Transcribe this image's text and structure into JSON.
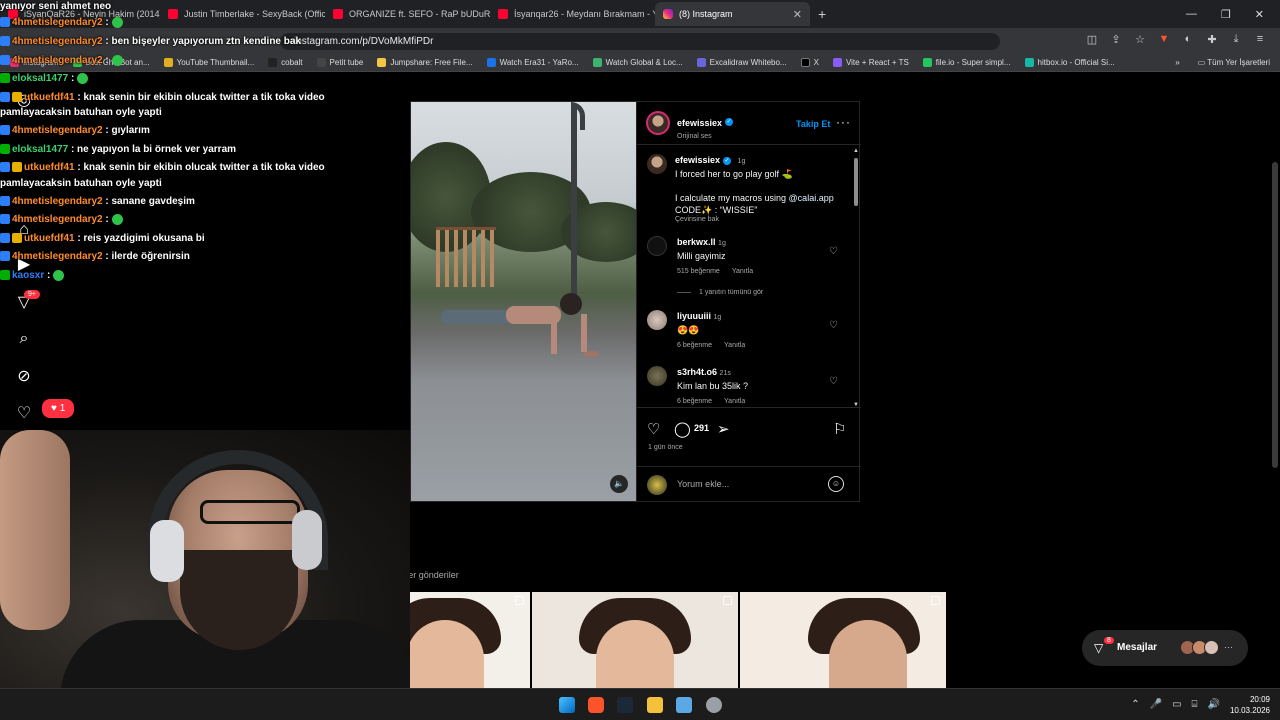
{
  "browser": {
    "tabs": [
      {
        "label": "iSyanQaR26 - Neyin Hakim (2014)",
        "favicon": "youtube-icon"
      },
      {
        "label": "Justin Timberlake - SexyBack (Official",
        "favicon": "youtube-icon"
      },
      {
        "label": "ORGANIZE ft. SEFO - RaP bUDuR bEy",
        "favicon": "youtube-icon"
      },
      {
        "label": "İsyanqar26 - Meydanı Bırakmam - Yo",
        "favicon": "youtube-icon"
      },
      {
        "label": "(8) Instagram",
        "favicon": "instagram-icon",
        "active": true
      }
    ],
    "url": "instagram.com/p/DVoMkMfiPDr",
    "bookmarks": [
      "Instagram",
      "best ChatBot an...",
      "YouTube Thumbnail...",
      "cobalt",
      "Petit tube",
      "Jumpshare: Free File...",
      "Watch Era31 - YaRo...",
      "Watch Global & Loc...",
      "Excalidraw Whitebo...",
      "X",
      "Vite + React + TS",
      "file.io - Super simpl...",
      "hitbox.io - Official Si..."
    ],
    "bookmarks_more": "»",
    "all_bookmarks": "Tüm Yer İşaretleri"
  },
  "post": {
    "author": "efewissiex",
    "audio": "Orijinal ses",
    "follow_label": "Takip Et",
    "caption": {
      "user": "efewissiex",
      "age": "1g",
      "line1": "I forced her to go play golf ⛳",
      "line2_prefix": "I calculate my macros using ",
      "line2_mention": "@calai.app",
      "line3": "CODE✨ : “WISSIE”",
      "translate": "Çevirisine bak"
    },
    "comments": [
      {
        "user": "berkwx.ll",
        "age": "1g",
        "text": "Milli gayimiz",
        "likes": "515 beğenme",
        "reply": "Yanıtla",
        "view_replies": "1 yanıtın tümünü gör"
      },
      {
        "user": "liyuuuiii",
        "age": "1g",
        "text": "😍😍",
        "likes": "6 beğenme",
        "reply": "Yanıtla"
      },
      {
        "user": "s3rh4t.o6",
        "age": "21s",
        "text": "Kim lan bu 35lik ?",
        "likes": "6 beğenme",
        "reply": "Yanıtla"
      }
    ],
    "comment_count": "291",
    "posted_ago": "1 gün önce",
    "comment_placeholder": "Yorum ekle..."
  },
  "more_posts": {
    "user": "efewissiex",
    "suffix": "'dan diğer gönderiler"
  },
  "sidebar": {
    "notification_badge": "9+",
    "likes_bubble": "1"
  },
  "messages": {
    "label": "Mesajlar",
    "badge": "8"
  },
  "chat": {
    "top_line": "yanıyor seni ahmet neo",
    "lines": [
      {
        "user": "4hmetislegendary2",
        "msg": ":",
        "color": "#ff8b2b"
      },
      {
        "user": "4hmetislegendary2",
        "msg": ": ben bişeyler yapıyorum ztn kendine bak",
        "color": "#ff8b2b"
      },
      {
        "user": "4hmetislegendary2",
        "msg": ":",
        "color": "#ff8b2b"
      },
      {
        "user": "eloksal1477",
        "msg": ":",
        "color": "#3bd16f"
      },
      {
        "user": "utkuefdf41",
        "msg": ": knak senin bir ekibin olucak twitter a tik toka video",
        "color": "#ff8b2b"
      },
      {
        "user": "",
        "msg": "pamlayacaksin batuhan oyle yapti",
        "color": "#fff"
      },
      {
        "user": "4hmetislegendary2",
        "msg": ": gıylarım",
        "color": "#ff8b2b"
      },
      {
        "user": "eloksal1477",
        "msg": ": ne yapıyon la bi örnek ver yarram",
        "color": "#3bd16f"
      },
      {
        "user": "utkuefdf41",
        "msg": ": knak senin bir ekibin olucak twitter a tik toka video",
        "color": "#ff8b2b"
      },
      {
        "user": "",
        "msg": "pamlayacaksin batuhan oyle yapti",
        "color": "#fff"
      },
      {
        "user": "4hmetislegendary2",
        "msg": ": sanane gavdeşim",
        "color": "#ff8b2b"
      },
      {
        "user": "4hmetislegendary2",
        "msg": ":",
        "color": "#ff8b2b"
      },
      {
        "user": "utkuefdf41",
        "msg": ": reis yazdigimi okusana bi",
        "color": "#ff8b2b"
      },
      {
        "user": "4hmetislegendary2",
        "msg": ": ilerde öğrenirsin",
        "color": "#ff8b2b"
      },
      {
        "user": "kaosxr",
        "msg": ":",
        "color": "#2d7ff9"
      }
    ]
  },
  "taskbar": {
    "time": "20:09",
    "date": "10.03.2026"
  },
  "colors": {
    "accent_blue": "#0095f6",
    "notification_red": "#ff3040",
    "background": "#000000"
  }
}
